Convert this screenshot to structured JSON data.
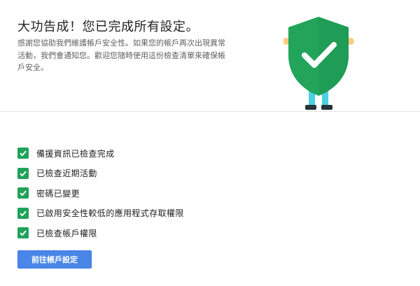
{
  "header": {
    "title": "大功告成！您已完成所有設定。",
    "description": "感謝您協助我們維護帳戶安全性。如果您的帳戶再次出現異常活動，我們會通知您。歡迎您隨時使用這份檢查清單來確保帳戶安全。",
    "illustration_icon": "shield-check-person-icon",
    "shield_color": "#22a45a"
  },
  "checklist": {
    "check_color": "#20a25a",
    "items": [
      {
        "label": "備援資訊已檢查完成",
        "checked": true
      },
      {
        "label": "已檢查近期活動",
        "checked": true
      },
      {
        "label": "密碼已變更",
        "checked": true
      },
      {
        "label": "已啟用安全性較低的應用程式存取權限",
        "checked": true
      },
      {
        "label": "已檢查帳戶權限",
        "checked": true
      }
    ]
  },
  "actions": {
    "primary_label": "前往帳戶設定",
    "primary_color": "#4a86e8"
  }
}
